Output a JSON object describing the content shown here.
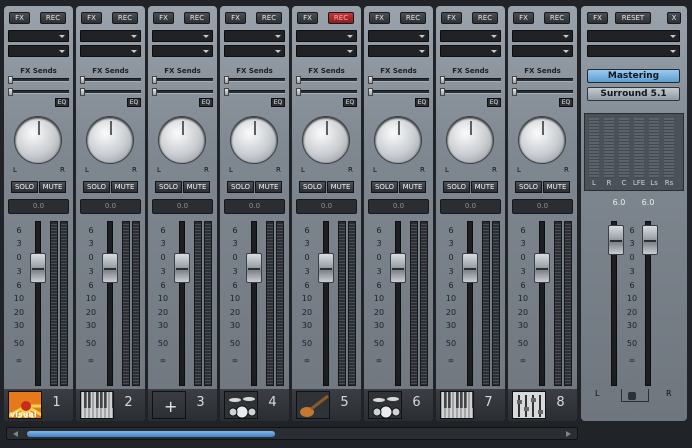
{
  "channels": [
    {
      "fx": "FX",
      "rec": "REC",
      "fx_sends": "FX Sends",
      "eq": "EQ",
      "l": "L",
      "r": "R",
      "solo": "SOLO",
      "mute": "MUTE",
      "value": "0.0",
      "number": "1",
      "thumb": "visual",
      "thumb_icon": "visual-icon"
    },
    {
      "fx": "FX",
      "rec": "REC",
      "fx_sends": "FX Sends",
      "eq": "EQ",
      "l": "L",
      "r": "R",
      "solo": "SOLO",
      "mute": "MUTE",
      "value": "0.0",
      "number": "2",
      "thumb_icon": "piano-icon"
    },
    {
      "fx": "FX",
      "rec": "REC",
      "fx_sends": "FX Sends",
      "eq": "EQ",
      "l": "L",
      "r": "R",
      "solo": "SOLO",
      "mute": "MUTE",
      "value": "0.0",
      "number": "3",
      "thumb": "+",
      "thumb_icon": "add-icon"
    },
    {
      "fx": "FX",
      "rec": "REC",
      "fx_sends": "FX Sends",
      "eq": "EQ",
      "l": "L",
      "r": "R",
      "solo": "SOLO",
      "mute": "MUTE",
      "value": "0.0",
      "number": "4",
      "thumb_icon": "drums-icon"
    },
    {
      "fx": "FX",
      "rec": "REC",
      "fx_sends": "FX Sends",
      "eq": "EQ",
      "l": "L",
      "r": "R",
      "solo": "SOLO",
      "mute": "MUTE",
      "value": "0.0",
      "number": "5",
      "thumb_icon": "guitar-icon"
    },
    {
      "fx": "FX",
      "rec": "REC",
      "fx_sends": "FX Sends",
      "eq": "EQ",
      "l": "L",
      "r": "R",
      "solo": "SOLO",
      "mute": "MUTE",
      "value": "0.0",
      "number": "6",
      "thumb_icon": "drums-icon"
    },
    {
      "fx": "FX",
      "rec": "REC",
      "fx_sends": "FX Sends",
      "eq": "EQ",
      "l": "L",
      "r": "R",
      "solo": "SOLO",
      "mute": "MUTE",
      "value": "0.0",
      "number": "7",
      "thumb_icon": "piano-icon"
    },
    {
      "fx": "FX",
      "rec": "REC",
      "fx_sends": "FX Sends",
      "eq": "EQ",
      "l": "L",
      "r": "R",
      "solo": "SOLO",
      "mute": "MUTE",
      "value": "0.0",
      "number": "8",
      "thumb_icon": "mixer-icon"
    }
  ],
  "scale": [
    "6",
    "3",
    "0",
    "3",
    "6",
    "10",
    "20",
    "30",
    "50",
    "∞"
  ],
  "master": {
    "fx": "FX",
    "reset": "RESET",
    "close": "X",
    "mastering": "Mastering",
    "surround": "Surround 5.1",
    "channels": [
      "L",
      "R",
      "C",
      "LFE",
      "Ls",
      "Rs"
    ],
    "left_value": "6.0",
    "right_value": "6.0",
    "scale": [
      "6",
      "3",
      "0",
      "3",
      "6",
      "10",
      "20",
      "30",
      "50",
      "∞"
    ],
    "l": "L",
    "r": "R"
  },
  "colors": {
    "accent": "#3f82c4",
    "rec_active": "#c8363a",
    "mastering": "#6fa8d6"
  }
}
